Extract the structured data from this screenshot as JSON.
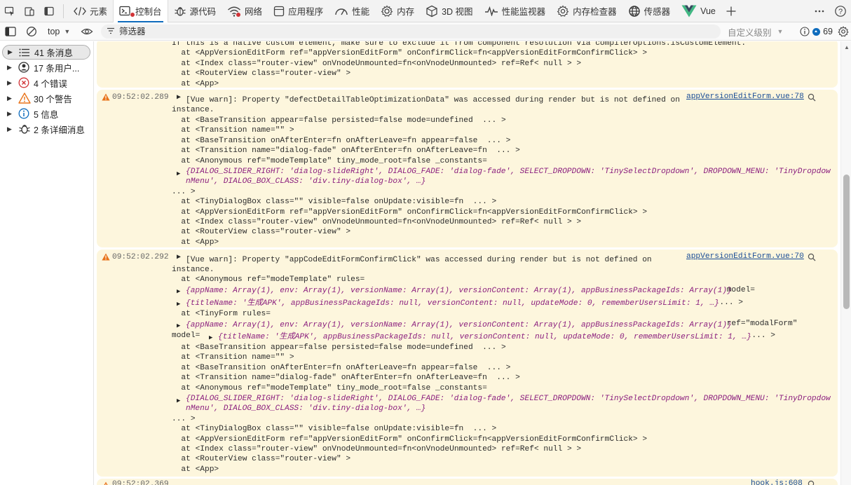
{
  "tabs": [
    {
      "id": "elements",
      "label": "元素",
      "icon": "code-icon"
    },
    {
      "id": "console",
      "label": "控制台",
      "icon": "console-icon",
      "active": true
    },
    {
      "id": "sources",
      "label": "源代码",
      "icon": "bug-icon"
    },
    {
      "id": "network",
      "label": "网络",
      "icon": "wifi-icon"
    },
    {
      "id": "application",
      "label": "应用程序",
      "icon": "app-icon"
    },
    {
      "id": "performance",
      "label": "性能",
      "icon": "gauge-icon"
    },
    {
      "id": "memory",
      "label": "内存",
      "icon": "memory-icon"
    },
    {
      "id": "3d",
      "label": "3D 视图",
      "icon": "cube-icon"
    },
    {
      "id": "perfmon",
      "label": "性能监视器",
      "icon": "pulse-icon"
    },
    {
      "id": "meminspect",
      "label": "内存检查器",
      "icon": "gear-icon"
    },
    {
      "id": "sensors",
      "label": "传感器",
      "icon": "globe-icon"
    },
    {
      "id": "vue",
      "label": "Vue",
      "icon": "vue-logo-icon"
    }
  ],
  "toolbar": {
    "context": "top",
    "filter_placeholder": "筛选器",
    "levels": "自定义级别",
    "issue_count": "69"
  },
  "sidebar": {
    "items": [
      {
        "label": "41 条消息",
        "icon": "list-icon",
        "selected": true
      },
      {
        "label": "17 条用户...",
        "icon": "user-icon"
      },
      {
        "label": "4 个错误",
        "icon": "error-icon"
      },
      {
        "label": "30 个警告",
        "icon": "warning-icon"
      },
      {
        "label": "5 信息",
        "icon": "info-icon"
      },
      {
        "label": "2 条详细消息",
        "icon": "bug-icon"
      }
    ]
  },
  "colors": {
    "warning_bg": "#fdf6dd",
    "link": "#1a4d96",
    "accent": "#0f6cbd",
    "error": "#d13438",
    "warning_icon": "#e8731a"
  },
  "console": {
    "msg0_lines": [
      "If this is a native custom element, make sure to exclude it from component resolution via compilerOptions.isCustomElement.",
      "  at <AppVersionEditForm ref=\"appVersionEditForm\" onConfirmClick=fn<appVersionEditFormConfirmClick> >",
      "  at <Index class=\"router-view\" onVnodeUnmounted=fn<onVnodeUnmounted> ref=Ref< null > >",
      "  at <RouterView class=\"router-view\" >",
      "  at <App>"
    ],
    "msg1": {
      "time": "09:52:02.289",
      "source": "appVersionEditForm.vue:78",
      "head": "[Vue warn]: Property \"defectDetailTableOptimizationData\" was accessed during render but is not defined on",
      "head2": "instance.",
      "lines_a": [
        "  at <BaseTransition appear=false persisted=false mode=undefined  ... >",
        "  at <Transition name=\"\" >",
        "  at <BaseTransition onAfterEnter=fn onAfterLeave=fn appear=false  ... >",
        "  at <Transition name=\"dialog-fade\" onAfterEnter=fn onAfterLeave=fn  ... >",
        "  at <Anonymous ref=\"modeTemplate\" tiny_mode_root=false _constants="
      ],
      "obj_line1": "{DIALOG_SLIDER_RIGHT: 'dialog-slideRight', DIALOG_FADE: 'dialog-fade', SELECT_DROPDOWN: 'TinySelectDropdown', DROPDOWN_MENU: 'TinyDropdow",
      "obj_line2": "nMenu', DIALOG_BOX_CLASS: 'div.tiny-dialog-box', …}",
      "cont": "... >",
      "lines_b": [
        "  at <TinyDialogBox class=\"\" visible=false onUpdate:visible=fn  ... >",
        "  at <AppVersionEditForm ref=\"appVersionEditForm\" onConfirmClick=fn<appVersionEditFormConfirmClick> >",
        "  at <Index class=\"router-view\" onVnodeUnmounted=fn<onVnodeUnmounted> ref=Ref< null > >",
        "  at <RouterView class=\"router-view\" >",
        "  at <App>"
      ]
    },
    "msg2": {
      "time": "09:52:02.292",
      "source": "appVersionEditForm.vue:70",
      "head": "[Vue warn]: Property \"appCodeEditFormConfirmClick\" was accessed during render but is not defined on",
      "head2": "instance.",
      "line_rules": "  at <Anonymous ref=\"modeTemplate\" rules=",
      "rules_obj": "{appName: Array(1), env: Array(1), versionName: Array(1), versionContent: Array(1), appBusinessPackageIds: Array(1)}",
      "model_label": " model=",
      "model_obj": "{titleName: '生成APK', appBusinessPackageIds: null, versionContent: null, updateMode: 0, rememberUsersLimit: 1, …}",
      "model_tail": "  ... >",
      "tinyform": "  at <TinyForm rules=",
      "rules_obj2": "{appName: Array(1), env: Array(1), versionName: Array(1), versionContent: Array(1), appBusinessPackageIds: Array(1)}",
      "ref_tail": " ref=\"modalForm\"",
      "model_prefix": "model=",
      "model_obj2": "{titleName: '生成APK', appBusinessPackageIds: null, versionContent: null, updateMode: 0, rememberUsersLimit: 1, …}",
      "model_tail2": "  ... >",
      "lines_a": [
        "  at <BaseTransition appear=false persisted=false mode=undefined  ... >",
        "  at <Transition name=\"\" >",
        "  at <BaseTransition onAfterEnter=fn onAfterLeave=fn appear=false  ... >",
        "  at <Transition name=\"dialog-fade\" onAfterEnter=fn onAfterLeave=fn  ... >",
        "  at <Anonymous ref=\"modeTemplate\" tiny_mode_root=false _constants="
      ],
      "obj_line1": "{DIALOG_SLIDER_RIGHT: 'dialog-slideRight', DIALOG_FADE: 'dialog-fade', SELECT_DROPDOWN: 'TinySelectDropdown', DROPDOWN_MENU: 'TinyDropdow",
      "obj_line2": "nMenu', DIALOG_BOX_CLASS: 'div.tiny-dialog-box', …}",
      "cont": "... >",
      "lines_b": [
        "  at <TinyDialogBox class=\"\" visible=false onUpdate:visible=fn  ... >",
        "  at <AppVersionEditForm ref=\"appVersionEditForm\" onConfirmClick=fn<appVersionEditFormConfirmClick> >",
        "  at <Index class=\"router-view\" onVnodeUnmounted=fn<onVnodeUnmounted> ref=Ref< null > >",
        "  at <RouterView class=\"router-view\" >",
        "  at <App>"
      ]
    },
    "msg3": {
      "time": "09:52:02.369",
      "source": "hook.js:608"
    }
  }
}
